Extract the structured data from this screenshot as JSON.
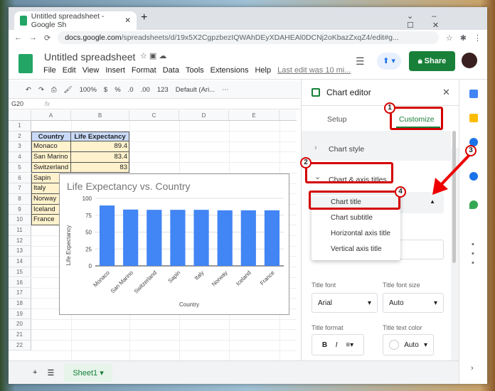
{
  "browser": {
    "tab_title": "Untitled spreadsheet - Google Sh",
    "url_host": "docs.google.com",
    "url_path": "/spreadsheets/d/19x5X2CgpzbezIQWAhDEyXDAHEAl0DCNj2oKbazZxqZ4/edit#g..."
  },
  "app": {
    "title": "Untitled spreadsheet",
    "menus": [
      "File",
      "Edit",
      "View",
      "Insert",
      "Format",
      "Data",
      "Tools",
      "Extensions",
      "Help"
    ],
    "last_edit": "Last edit was 10 mi...",
    "share": "Share"
  },
  "toolbar": {
    "zoom": "100%",
    "currency": "$",
    "percent": "%",
    "dec_less": ".0",
    "dec_more": ".00",
    "format": "123",
    "font": "Default (Ari...",
    "more": "⋯"
  },
  "formula_bar": {
    "cell_ref": "G20",
    "fx": "fx"
  },
  "grid": {
    "columns": [
      "A",
      "B",
      "C",
      "D",
      "E"
    ],
    "rows": [
      "1",
      "2",
      "3",
      "4",
      "5",
      "6",
      "7",
      "8",
      "9",
      "10",
      "11",
      "12",
      "13",
      "14",
      "15",
      "16",
      "17",
      "18",
      "19",
      "20",
      "21",
      "22"
    ],
    "header": [
      "Country",
      "Life Expectancy"
    ],
    "data": [
      [
        "Monaco",
        "89.4"
      ],
      [
        "San Marino",
        "83.4"
      ],
      [
        "Switzerland",
        "83"
      ],
      [
        "Sapin",
        ""
      ],
      [
        "Italy",
        ""
      ],
      [
        "Norway",
        ""
      ],
      [
        "Iceland",
        ""
      ],
      [
        "France",
        ""
      ]
    ]
  },
  "chart_data": {
    "type": "bar",
    "title": "Life Expectancy vs. Country",
    "xlabel": "Country",
    "ylabel": "Life Expectancy",
    "categories": [
      "Monaco",
      "San Marino",
      "Switzerland",
      "Sapin",
      "Italy",
      "Norway",
      "Iceland",
      "France"
    ],
    "values": [
      89.4,
      83.4,
      83,
      83,
      83,
      82.3,
      82.3,
      82.3
    ],
    "ylim": [
      0,
      100
    ],
    "yticks": [
      "0",
      "25",
      "50",
      "75",
      "100"
    ],
    "color": "#4285f4",
    "grid": true
  },
  "editor": {
    "title": "Chart editor",
    "tabs": [
      "Setup",
      "Customize"
    ],
    "sections": [
      "Chart style",
      "Chart & axis titles"
    ],
    "dropdown_options": [
      "Chart title",
      "Chart subtitle",
      "Horizontal axis title",
      "Vertical axis title"
    ],
    "title_font_label": "Title font",
    "title_font": "Arial",
    "title_size_label": "Title font size",
    "title_size": "Auto",
    "title_format_label": "Title format",
    "bold": "B",
    "italic": "I",
    "title_color_label": "Title text color",
    "title_color": "Auto"
  },
  "annotations": [
    "1",
    "2",
    "3",
    "4"
  ],
  "sheets": {
    "active": "Sheet1"
  }
}
